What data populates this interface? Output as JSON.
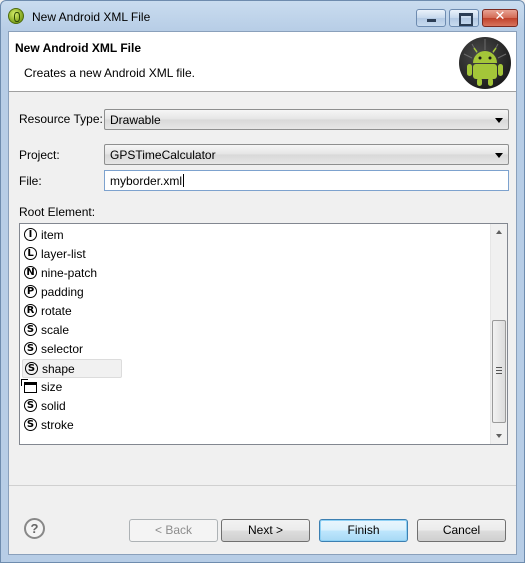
{
  "window": {
    "title": "New Android XML File"
  },
  "header": {
    "title": "New Android XML File",
    "description": "Creates a new Android XML file."
  },
  "form": {
    "resource_type_label": "Resource Type:",
    "resource_type_value": "Drawable",
    "project_label": "Project:",
    "project_value": "GPSTimeCalculator",
    "file_label": "File:",
    "file_value": "myborder.xml",
    "root_element_label": "Root Element:"
  },
  "root_elements": [
    {
      "label": "item",
      "icon_letter": "I"
    },
    {
      "label": "layer-list",
      "icon_letter": "L"
    },
    {
      "label": "nine-patch",
      "icon_letter": "N"
    },
    {
      "label": "padding",
      "icon_letter": "P"
    },
    {
      "label": "rotate",
      "icon_letter": "R"
    },
    {
      "label": "scale",
      "icon_letter": "S"
    },
    {
      "label": "selector",
      "icon_letter": "S"
    },
    {
      "label": "shape",
      "icon_letter": "S"
    },
    {
      "label": "size",
      "icon_letter": ""
    },
    {
      "label": "solid",
      "icon_letter": "S"
    },
    {
      "label": "stroke",
      "icon_letter": "S"
    }
  ],
  "selected_root_element": "shape",
  "buttons": {
    "help": "?",
    "back": "< Back",
    "next": "Next >",
    "finish": "Finish",
    "cancel": "Cancel"
  },
  "icons": {
    "app": "android-eclipse-icon",
    "header_logo": "android-logo-icon",
    "help": "help-icon"
  },
  "colors": {
    "titlebar": "#b7cde6",
    "close_button": "#c0412a",
    "android_green": "#a4c639",
    "default_button_border": "#3c7fb1"
  }
}
